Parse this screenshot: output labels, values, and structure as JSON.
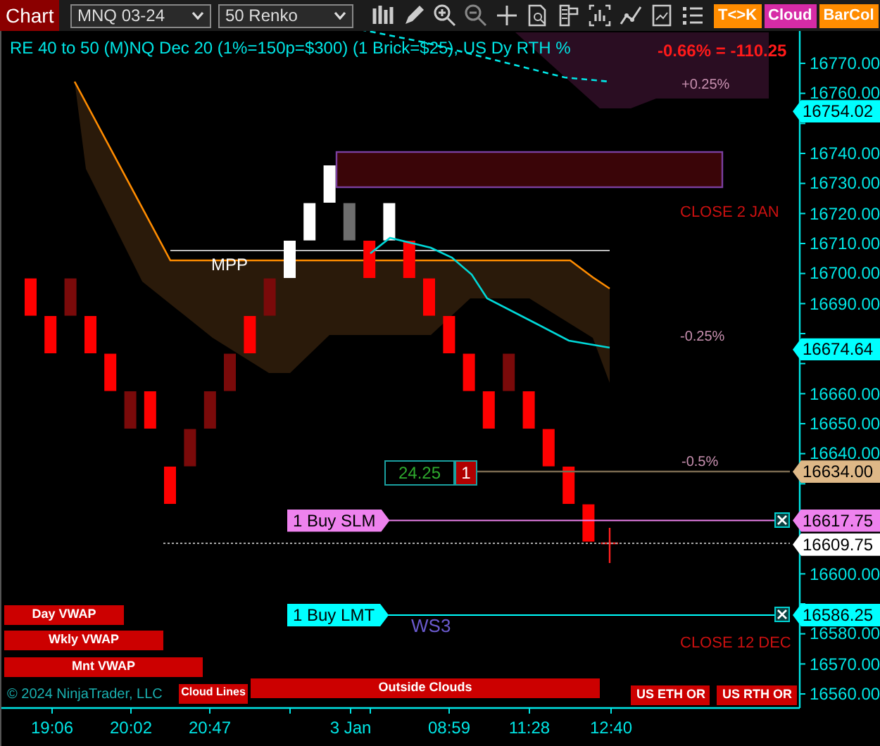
{
  "toolbar": {
    "title": "Chart",
    "instrument": "MNQ 03-24",
    "bar_type": "50 Renko",
    "toggles": [
      {
        "label": "T<>K",
        "color": "#ff8c00"
      },
      {
        "label": "Cloud",
        "color": "#d62ba6"
      },
      {
        "label": "BarCol",
        "color": "#ff8c00"
      }
    ]
  },
  "chart": {
    "header": "RE 40 to 50 (M)NQ Dec 20 (1%=150p=$300) (1 Brick=$25), US Dy RTH %",
    "change": "-0.66% = -110.25",
    "price_axis": [
      "16770.00",
      "16760.00",
      "16740.00",
      "16730.00",
      "16720.00",
      "16710.00",
      "16700.00",
      "16690.00",
      "16660.00",
      "16650.00",
      "16640.00",
      "16600.00",
      "16580.00",
      "16570.00",
      "16560.00"
    ],
    "time_axis": [
      "19:06",
      "20:02",
      "20:47",
      "3 Jan",
      "08:59",
      "11:28",
      "12:40"
    ],
    "level_labels": [
      {
        "text": "+0.25%",
        "kind": "percent"
      },
      {
        "text": "CLOSE 2 JAN",
        "kind": "close"
      },
      {
        "text": "-0.25%",
        "kind": "percent"
      },
      {
        "text": "-0.5%",
        "kind": "percent"
      },
      {
        "text": "CLOSE 12 DEC",
        "kind": "close"
      }
    ],
    "line_labels": [
      {
        "text": "MPP",
        "color": "#ffffff"
      },
      {
        "text": "WS3",
        "color": "#6a5acd"
      }
    ],
    "position": {
      "pnl": "24.25",
      "quantity": "1"
    },
    "orders": [
      {
        "label": "1 Buy SLM",
        "price": "16617.75",
        "color": "#ee82ee"
      },
      {
        "label": "1 Buy LMT",
        "price": "16586.25",
        "color": "#00ffff"
      }
    ],
    "price_flags": [
      {
        "text": "16754.02",
        "color": "#00ffff"
      },
      {
        "text": "16674.64",
        "color": "#00ffff"
      },
      {
        "text": "16634.00",
        "color": "#deb887"
      },
      {
        "text": "16609.75",
        "color": "#ffffff"
      }
    ],
    "indicator_bars": [
      "Day VWAP",
      "Wkly VWAP",
      "Mnt VWAP",
      "Cloud Lines",
      "Outside Clouds",
      "US ETH OR",
      "US RTH OR"
    ],
    "copyright": "© 2024 NinjaTrader, LLC"
  }
}
